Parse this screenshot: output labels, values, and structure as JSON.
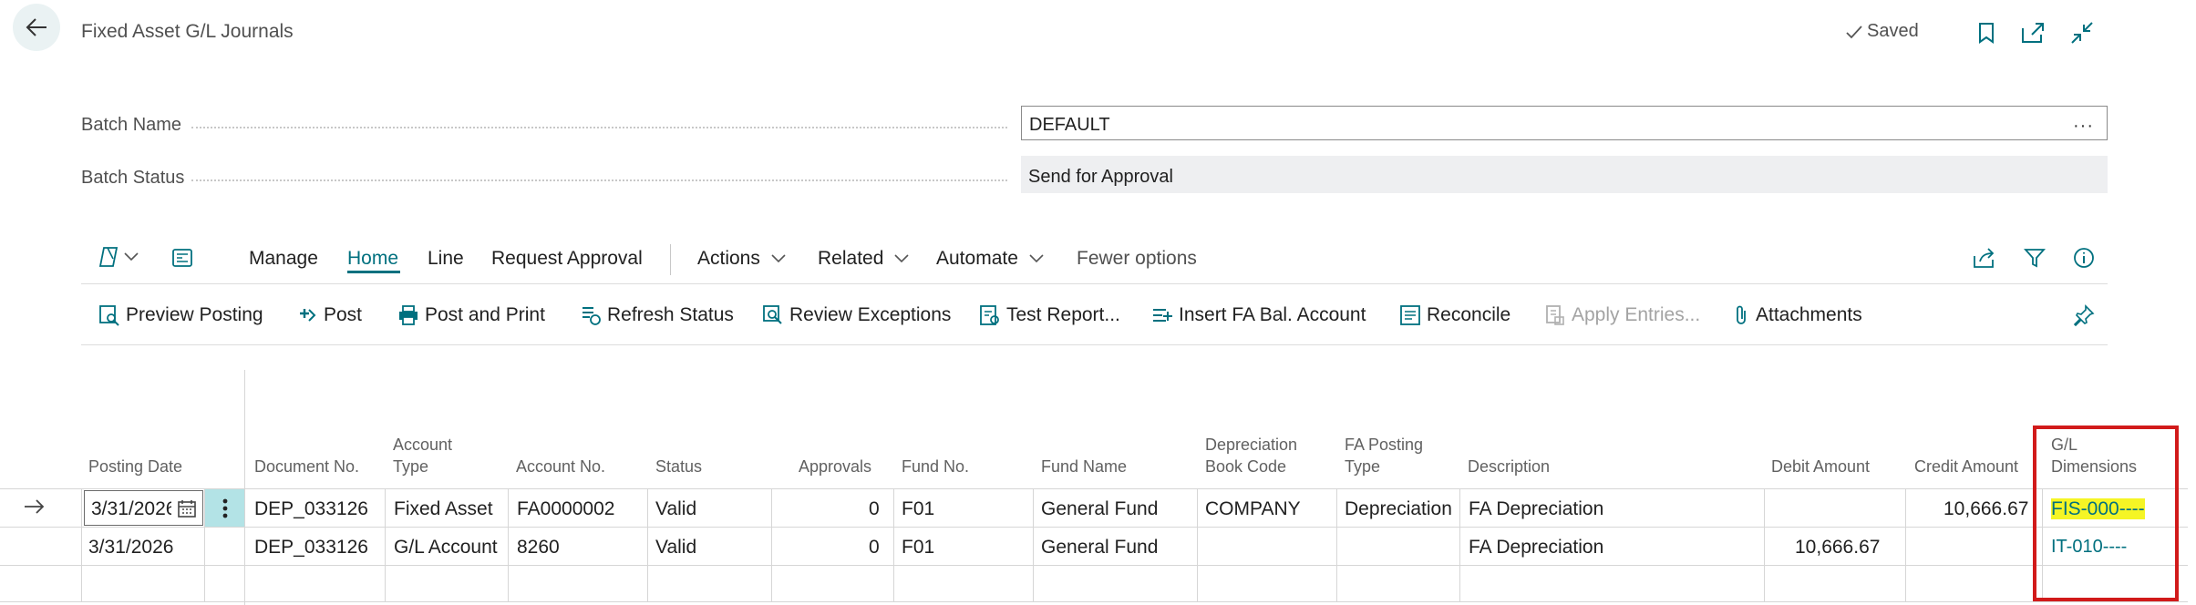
{
  "header": {
    "title": "Fixed Asset G/L Journals",
    "saved_label": "Saved"
  },
  "fields": {
    "batch_name_label": "Batch Name",
    "batch_name_value": "DEFAULT",
    "batch_name_ellipsis": "···",
    "batch_status_label": "Batch Status",
    "batch_status_value": "Send for Approval"
  },
  "menu": {
    "manage": "Manage",
    "home": "Home",
    "line": "Line",
    "request_approval": "Request Approval",
    "actions": "Actions",
    "related": "Related",
    "automate": "Automate",
    "fewer_options": "Fewer options"
  },
  "actions": {
    "preview_posting": "Preview Posting",
    "post": "Post",
    "post_and_print": "Post and Print",
    "refresh_status": "Refresh Status",
    "review_exceptions": "Review Exceptions",
    "test_report": "Test Report...",
    "insert_fa_bal_account": "Insert FA Bal. Account",
    "reconcile": "Reconcile",
    "apply_entries": "Apply Entries...",
    "attachments": "Attachments"
  },
  "grid": {
    "headers": {
      "posting_date": "Posting Date",
      "document_no": "Document No.",
      "account_type_1": "Account",
      "account_type_2": "Type",
      "account_no": "Account No.",
      "status": "Status",
      "approvals": "Approvals",
      "fund_no": "Fund No.",
      "fund_name": "Fund Name",
      "dep_book_1": "Depreciation",
      "dep_book_2": "Book Code",
      "fa_posting_1": "FA Posting",
      "fa_posting_2": "Type",
      "description": "Description",
      "debit_amount": "Debit Amount",
      "credit_amount": "Credit Amount",
      "gl_dims_1": "G/L",
      "gl_dims_2": "Dimensions"
    },
    "rows": [
      {
        "posting_date": "3/31/2026",
        "document_no": "DEP_033126",
        "account_type": "Fixed Asset",
        "account_no": "FA0000002",
        "status": "Valid",
        "approvals": "0",
        "fund_no": "F01",
        "fund_name": "General Fund",
        "dep_book_code": "COMPANY",
        "fa_posting_type": "Depreciation",
        "description": "FA Depreciation",
        "debit_amount": "",
        "credit_amount": "10,666.67",
        "gl_dimensions": "FIS-000----"
      },
      {
        "posting_date": "3/31/2026",
        "document_no": "DEP_033126",
        "account_type": "G/L Account",
        "account_no": "8260",
        "status": "Valid",
        "approvals": "0",
        "fund_no": "F01",
        "fund_name": "General Fund",
        "dep_book_code": "",
        "fa_posting_type": "",
        "description": "FA Depreciation",
        "debit_amount": "10,666.67",
        "credit_amount": "",
        "gl_dimensions": "IT-010----"
      }
    ]
  },
  "colors": {
    "accent": "#00707f",
    "highlight": "#f5f525",
    "annotation_box": "#d11a1a"
  }
}
